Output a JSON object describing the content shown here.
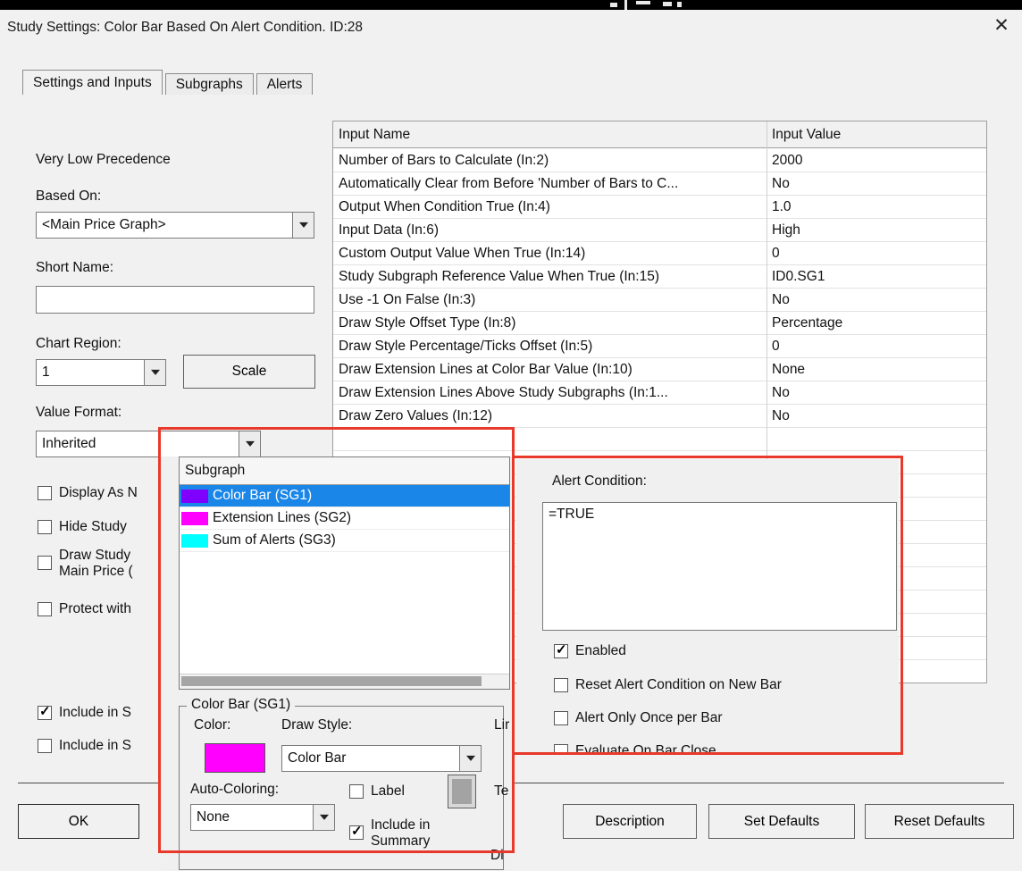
{
  "title_bar": {
    "title": "Study Settings: Color Bar Based On Alert Condition. ID:28",
    "close_glyph": "✕"
  },
  "tabs": [
    {
      "label": "Settings and Inputs",
      "selected": true
    },
    {
      "label": "Subgraphs",
      "selected": false
    },
    {
      "label": "Alerts",
      "selected": false
    }
  ],
  "left_panel": {
    "precedence_text": "Very Low Precedence",
    "based_on": {
      "label": "Based On:",
      "value": "<Main Price Graph>"
    },
    "short_name": {
      "label": "Short Name:",
      "value": ""
    },
    "chart_region": {
      "label": "Chart Region:",
      "value": "1",
      "scale_button": "Scale"
    },
    "value_format": {
      "label": "Value Format:",
      "value": "Inherited"
    },
    "checkboxes": [
      {
        "label": "Display As N",
        "checked": false
      },
      {
        "label": "Hide Study",
        "checked": false
      },
      {
        "label": "Draw Study",
        "label_line2": "Main Price (",
        "checked": false
      },
      {
        "label": "Protect with",
        "checked": false
      },
      {
        "label": "Include in S",
        "checked": true
      },
      {
        "label": "Include in S",
        "checked": false
      }
    ]
  },
  "inputs_table": {
    "headers": [
      "Input Name",
      "Input Value"
    ],
    "rows": [
      [
        "Number of Bars to Calculate  (In:2)",
        "2000"
      ],
      [
        "Automatically Clear from Before 'Number of Bars to C...",
        "No"
      ],
      [
        "Output When Condition True  (In:4)",
        "1.0"
      ],
      [
        "Input Data  (In:6)",
        "High"
      ],
      [
        "Custom Output Value When True  (In:14)",
        "0"
      ],
      [
        "Study Subgraph Reference Value When True  (In:15)",
        "ID0.SG1"
      ],
      [
        "Use -1 On False  (In:3)",
        "No"
      ],
      [
        "Draw Style Offset Type  (In:8)",
        "Percentage"
      ],
      [
        "Draw Style Percentage/Ticks Offset  (In:5)",
        "0"
      ],
      [
        "Draw Extension Lines at Color Bar Value  (In:10)",
        "None"
      ],
      [
        "Draw Extension Lines Above Study Subgraphs  (In:1...",
        "No"
      ],
      [
        "Draw Zero Values  (In:12)",
        "No"
      ]
    ]
  },
  "subgraph_popup": {
    "list_header": "Subgraph",
    "items": [
      {
        "label": "Color Bar (SG1)",
        "color": "#8000ff",
        "selected": true
      },
      {
        "label": "Extension Lines (SG2)",
        "color": "#ff00ff",
        "selected": false
      },
      {
        "label": "Sum of Alerts (SG3)",
        "color": "#00ffff",
        "selected": false
      }
    ],
    "group": {
      "title": "Color Bar (SG1)",
      "color_label": "Color:",
      "color_value": "#ff00ff",
      "draw_style_label": "Draw Style:",
      "draw_style_value": "Color Bar",
      "auto_coloring_label": "Auto-Coloring:",
      "auto_coloring_value": "None",
      "label_checkbox": {
        "label": "Label",
        "checked": false
      },
      "include_checkbox": {
        "label": "Include in",
        "label_line2": "Summary",
        "checked": true
      },
      "partial_line_label": "Lir",
      "partial_text_label": "Te",
      "partial_display_label": "Di"
    }
  },
  "alert_popup": {
    "condition_label": "Alert Condition:",
    "condition_value": "=TRUE",
    "checkboxes": [
      {
        "label": "Enabled",
        "checked": true
      },
      {
        "label": "Reset Alert Condition on New Bar",
        "checked": false
      },
      {
        "label": "Alert Only Once per Bar",
        "checked": false
      },
      {
        "label": "Evaluate On Bar Close",
        "checked": false
      }
    ]
  },
  "footer": {
    "ok": "OK",
    "description": "Description",
    "set_defaults": "Set Defaults",
    "reset_defaults": "Reset Defaults"
  },
  "colors": {
    "selection_blue": "#1a86e8",
    "annotation_red": "#e8392b"
  }
}
